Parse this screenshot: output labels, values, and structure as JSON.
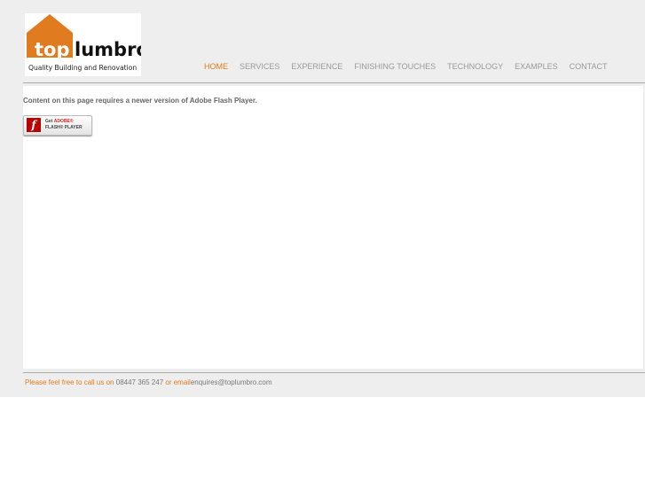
{
  "logo": {
    "word1": "top",
    "word2": "lumbro",
    "tagline": "Quality Building and Renovation"
  },
  "nav": [
    {
      "label": "HOME",
      "active": true
    },
    {
      "label": "SERVICES"
    },
    {
      "label": "EXPERIENCE"
    },
    {
      "label": "FINISHING TOUCHES"
    },
    {
      "label": "TECHNOLOGY"
    },
    {
      "label": "EXAMPLES"
    },
    {
      "label": "CONTACT"
    }
  ],
  "content": {
    "message": "Content on this page requires a newer version of Adobe Flash Player.",
    "flash_get": "Get",
    "flash_adobe": "ADOBE®",
    "flash_player": "FLASH® PLAYER"
  },
  "footer": {
    "pre": "Please feel free to call us on",
    "phone": "08447 365 247",
    "mid": "or email",
    "email": "enquires@toplumbro.com"
  },
  "colors": {
    "accent": "#e07b1f",
    "background": "#eeeeee"
  }
}
